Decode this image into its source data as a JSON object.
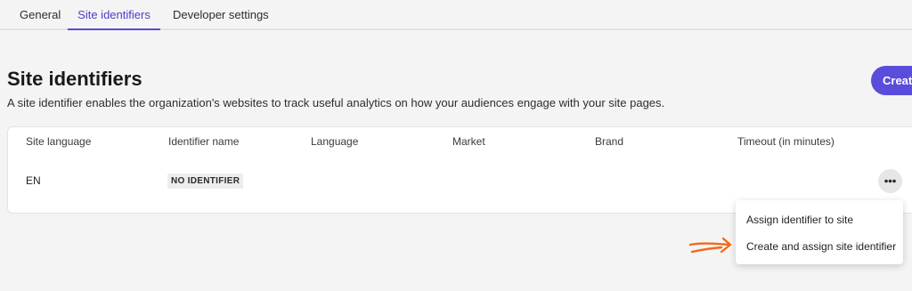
{
  "tabs": {
    "general": "General",
    "site_identifiers": "Site identifiers",
    "developer_settings": "Developer settings",
    "active": "Site identifiers"
  },
  "header": {
    "title": "Site identifiers",
    "description": "A site identifier enables the organization's websites to track useful analytics on how your audiences engage with your site pages.",
    "create_button": "Create"
  },
  "table": {
    "columns": [
      "Site language",
      "Identifier name",
      "Language",
      "Market",
      "Brand",
      "Timeout (in minutes)"
    ],
    "rows": [
      {
        "site_language": "EN",
        "identifier_badge": "NO IDENTIFIER",
        "language": "",
        "market": "",
        "brand": "",
        "timeout": ""
      }
    ]
  },
  "row_menu": {
    "icon": "more-horizontal-icon",
    "items": [
      "Assign identifier to site",
      "Create and assign site identifier"
    ]
  },
  "annotation": {
    "icon": "hand-drawn-arrow-icon",
    "color": "#f26a1b"
  },
  "colors": {
    "accent": "#5b4ddb",
    "tab_active_text": "#4b3fc7",
    "background": "#f4f4f4"
  }
}
